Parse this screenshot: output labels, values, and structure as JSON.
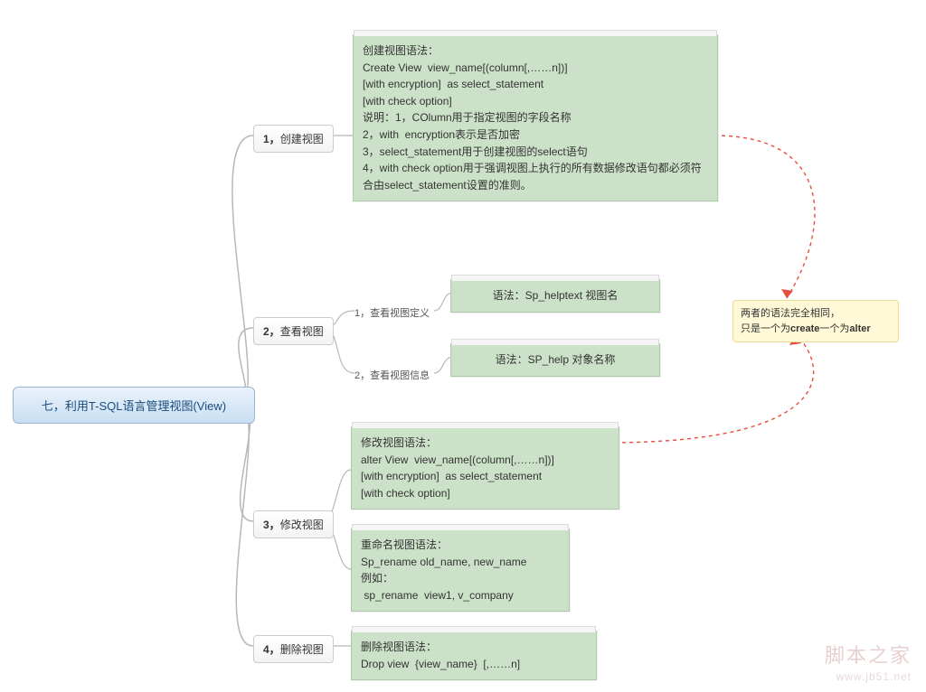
{
  "root": {
    "title": "七，利用T-SQL语言管理视图(View)"
  },
  "branches": [
    {
      "num": "1，",
      "label": "创建视图"
    },
    {
      "num": "2，",
      "label": "查看视图"
    },
    {
      "num": "3，",
      "label": "修改视图"
    },
    {
      "num": "4，",
      "label": "删除视图"
    }
  ],
  "details": {
    "create": "创建视图语法：\nCreate View  view_name[(column[,……n])]\n[with encryption]  as select_statement\n[with check option]\n说明：1，COlumn用于指定视图的字段名称\n2，with  encryption表示是否加密\n3，select_statement用于创建视图的select语句\n4，with check option用于强调视图上执行的所有数据修改语句都必须符合由select_statement设置的准则。",
    "view_def_label": "1，查看视图定义",
    "view_def": "语法：Sp_helptext  视图名",
    "view_info_label": "2，查看视图信息",
    "view_info": "语法：SP_help  对象名称",
    "alter": "修改视图语法：\nalter View  view_name[(column[,……n])]\n[with encryption]  as select_statement\n[with check option]",
    "rename": "重命名视图语法：\nSp_rename old_name, new_name\n例如：\n sp_rename  view1, v_company",
    "drop": "删除视图语法：\nDrop view  {view_name}  [,……n]"
  },
  "note": {
    "line1": "两者的语法完全相同，",
    "line2_a": "只是一个为",
    "line2_b": "create",
    "line2_c": "一个为",
    "line2_d": "alter"
  },
  "watermark": {
    "cn": "脚本之家",
    "en": "www.jb51.net"
  }
}
